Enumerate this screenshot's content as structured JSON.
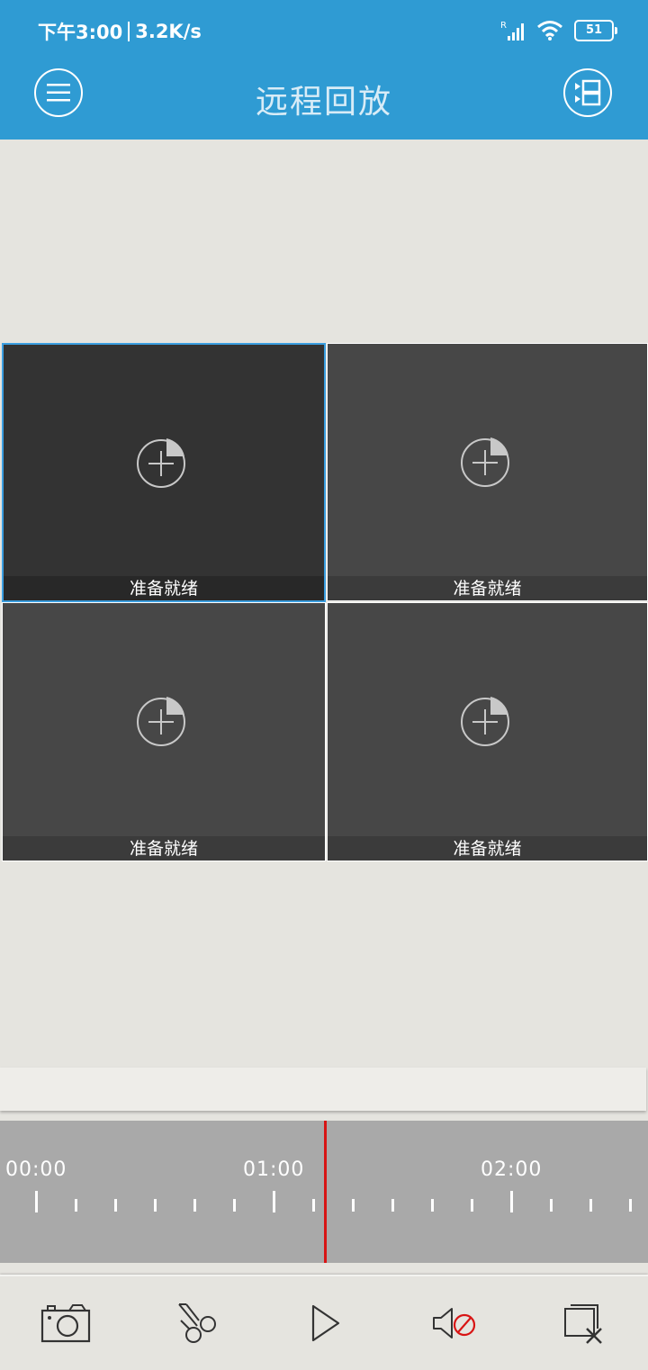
{
  "status_bar": {
    "time": "下午3:00",
    "speed": "3.2K/s",
    "battery": "51",
    "icons": [
      "signal-icon",
      "wifi-icon",
      "battery-icon"
    ]
  },
  "header": {
    "title": "远程回放",
    "left_icon": "menu-icon",
    "right_icon": "playlist-icon"
  },
  "cells": [
    {
      "status": "准备就绪",
      "active": true
    },
    {
      "status": "准备就绪",
      "active": false
    },
    {
      "status": "准备就绪",
      "active": false
    },
    {
      "status": "准备就绪",
      "active": false
    }
  ],
  "timeline": {
    "labels": [
      "00:00",
      "01:00",
      "02:00"
    ]
  },
  "toolbar": {
    "icons": [
      "camera-icon",
      "scissors-icon",
      "play-icon",
      "mute-icon",
      "close-window-icon"
    ]
  },
  "colors": {
    "header": "#2f9bd3",
    "active_border": "#3b9ee0",
    "playhead": "#d81414"
  }
}
